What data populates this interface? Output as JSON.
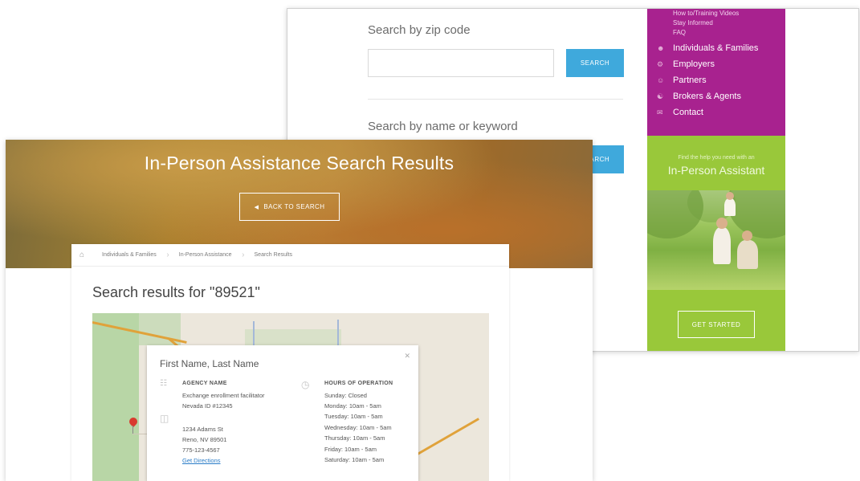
{
  "back_window": {
    "zip_label": "Search by zip code",
    "zip_value": "",
    "zip_button": "SEARCH",
    "keyword_label": "Search by name or keyword",
    "keyword_button": "SEARCH",
    "nav_small": [
      "How to/Training Videos",
      "Stay Informed",
      "FAQ"
    ],
    "nav_items": [
      {
        "label": "Individuals & Families",
        "icon": "people-icon"
      },
      {
        "label": "Employers",
        "icon": "person-icon"
      },
      {
        "label": "Partners",
        "icon": "partner-icon"
      },
      {
        "label": "Brokers & Agents",
        "icon": "brokers-icon"
      },
      {
        "label": "Contact",
        "icon": "mail-icon"
      }
    ],
    "promo_small": "Find the help you need with an",
    "promo_title": "In-Person Assistant",
    "promo_button": "GET STARTED",
    "colors": {
      "nav_bg": "#a8228f",
      "promo_bg": "#99c83a",
      "button_bg": "#3fa9dc"
    }
  },
  "front_window": {
    "hero_title": "In-Person Assistance Search Results",
    "back_button": "BACK TO SEARCH",
    "breadcrumb": [
      "Individuals & Families",
      "In-Person Assistance",
      "Search Results"
    ],
    "results_heading": "Search results for \"89521\"",
    "info_card": {
      "name": "First Name, Last Name",
      "agency_heading": "AGENCY NAME",
      "agency_lines": [
        "Exchange enrollment facilitator",
        "Nevada ID #12345"
      ],
      "address_lines": [
        "1234 Adams St",
        "Reno, NV 89501",
        "775-123-4567"
      ],
      "directions": "Get Directions",
      "hours_heading": "HOURS OF OPERATION",
      "hours": [
        "Sunday: Closed",
        "Monday: 10am - 5am",
        "Tuesday: 10am - 5am",
        "Wednesday: 10am - 5am",
        "Thursday: 10am - 5am",
        "Friday: 10am - 5am",
        "Saturday: 10am - 5am"
      ]
    }
  }
}
